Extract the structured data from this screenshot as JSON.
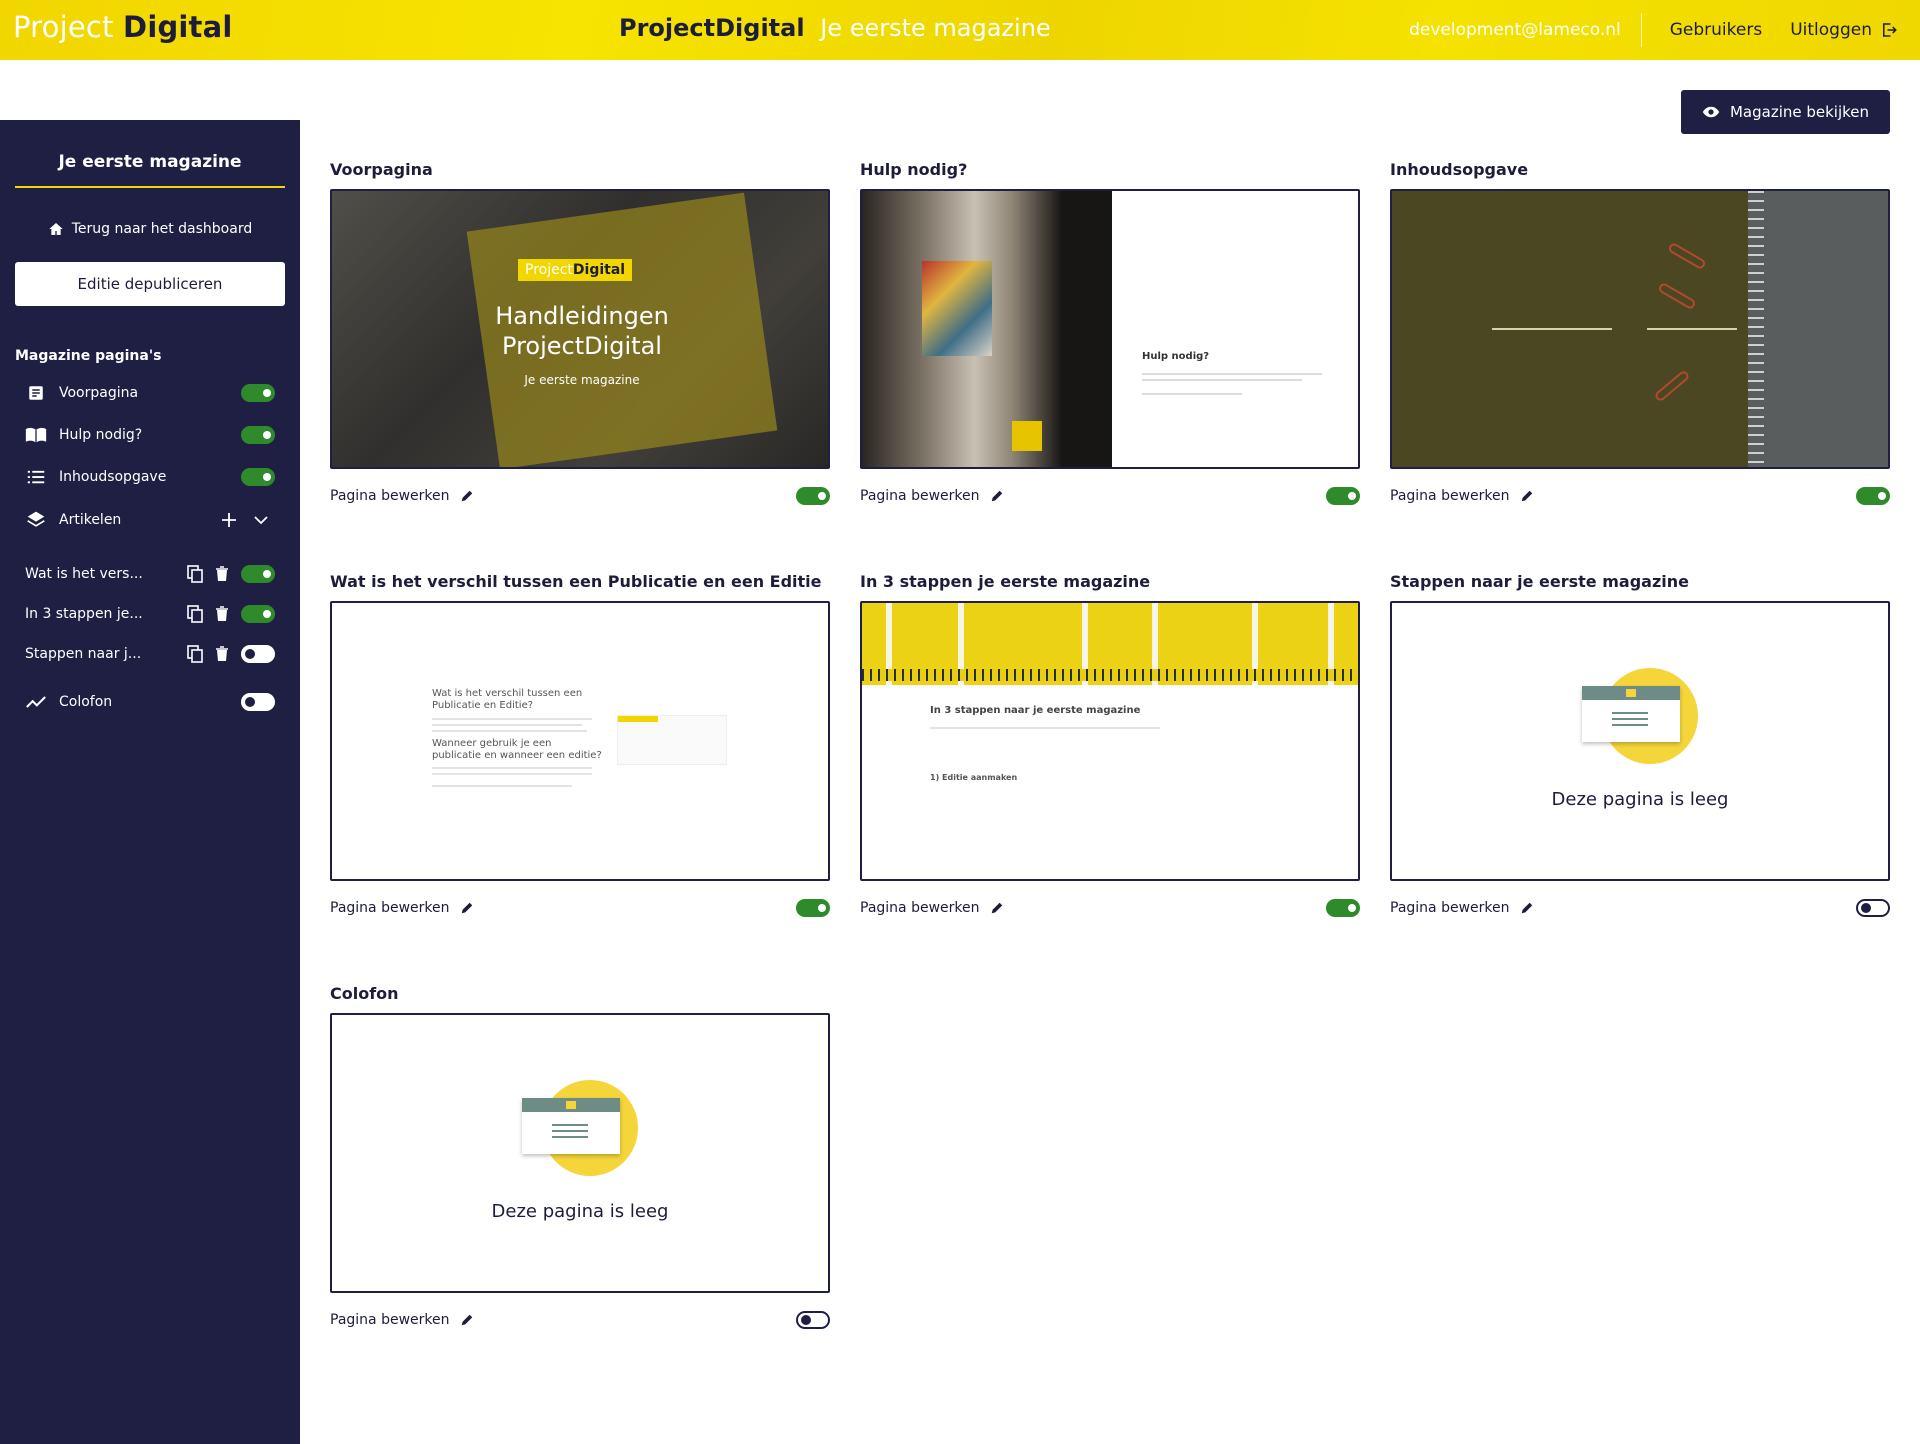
{
  "header": {
    "logo_light": "Project",
    "logo_bold": "Digital",
    "brand": "ProjectDigital",
    "magazine": "Je eerste magazine",
    "email": "development@lameco.nl",
    "users": "Gebruikers",
    "logout": "Uitloggen"
  },
  "sidebar": {
    "title": "Je eerste magazine",
    "back": "Terug naar het dashboard",
    "duplicate": "Editie depubliceren",
    "section": "Magazine pagina's",
    "items": [
      {
        "label": "Voorpagina",
        "icon": "document-icon",
        "enabled": true
      },
      {
        "label": "Hulp nodig?",
        "icon": "book-icon",
        "enabled": true
      },
      {
        "label": "Inhoudsopgave",
        "icon": "list-icon",
        "enabled": true
      },
      {
        "label": "Artikelen",
        "icon": "layers-icon"
      }
    ],
    "articles": [
      {
        "label": "Wat is het vers...",
        "enabled": true
      },
      {
        "label": "In 3 stappen je...",
        "enabled": true
      },
      {
        "label": "Stappen naar j...",
        "enabled": false
      }
    ],
    "colofon": {
      "label": "Colofon",
      "icon": "chart-line-icon",
      "enabled": false
    }
  },
  "main": {
    "view_button": "Magazine bekijken",
    "edit_label": "Pagina bewerken",
    "empty_text": "Deze pagina is leeg",
    "cards": [
      {
        "title": "Voorpagina",
        "enabled": true
      },
      {
        "title": "Hulp nodig?",
        "enabled": true
      },
      {
        "title": "Inhoudsopgave",
        "enabled": true
      },
      {
        "title": "Wat is het verschil tussen een Publicatie en een Editie",
        "enabled": true
      },
      {
        "title": "In 3 stappen je eerste magazine",
        "enabled": true
      },
      {
        "title": "Stappen naar je eerste magazine",
        "enabled": false
      },
      {
        "title": "Colofon",
        "enabled": false
      }
    ],
    "front": {
      "badge_light": "Project",
      "badge_bold": "Digital",
      "title": "Handleidingen ProjectDigital",
      "subtitle": "Je eerste magazine"
    },
    "help": {
      "heading": "Hulp nodig?"
    },
    "diff": {
      "heading1": "Wat is het verschil tussen een Publicatie en Editie?",
      "heading2": "Wanneer gebruik je een publicatie en wanneer een editie?"
    },
    "steps": {
      "heading": "In 3 stappen naar je eerste magazine",
      "step1": "1) Editie aanmaken"
    }
  },
  "colors": {
    "accent": "#f1d600",
    "navy": "#1f1f44",
    "toggle_on": "#2e8a2a"
  }
}
